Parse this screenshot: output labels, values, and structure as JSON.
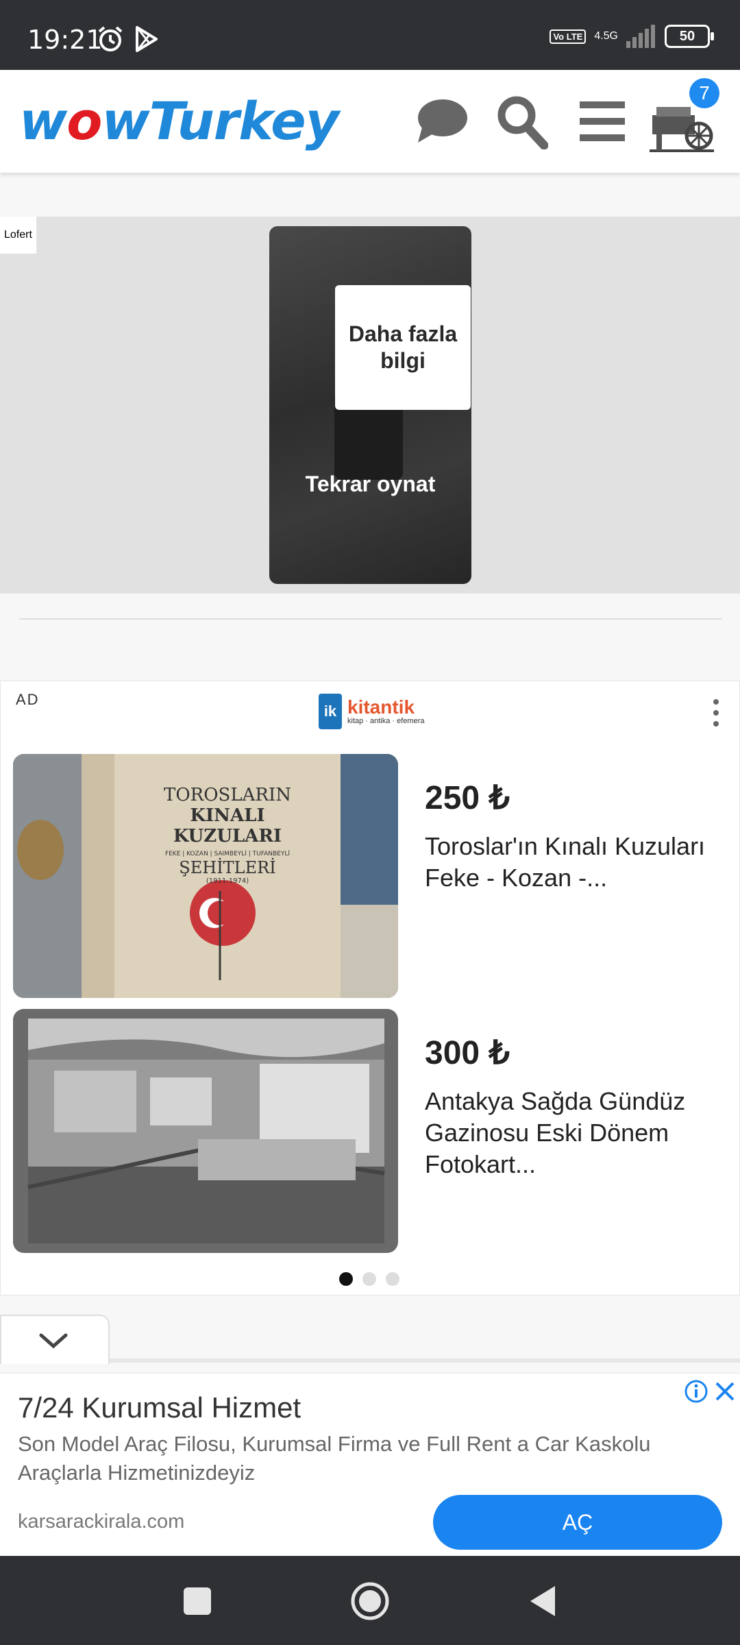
{
  "status_bar": {
    "time": "19:21",
    "volte": "Vo LTE",
    "network": "4.5G",
    "battery": "50"
  },
  "header": {
    "logo_prefix": "w",
    "logo_o": "o",
    "logo_suffix": "wTurkey",
    "cart_badge": "7"
  },
  "video_ad": {
    "label": "Lofert",
    "more_info": "Daha fazla bilgi",
    "replay": "Tekrar oynat"
  },
  "product_ad": {
    "ad_label": "AD",
    "brand": "kitantik",
    "brand_tagline": "kitap · antika · efemera",
    "products": [
      {
        "price": "250 ₺",
        "title": "Toroslar'ın Kınalı Kuzuları Feke - Kozan -...",
        "cover_title_1": "TOROSLARIN",
        "cover_title_2": "KINALI",
        "cover_title_3": "KUZULARI",
        "cover_sub": "FEKE | KOZAN | SAIMBEYLİ | TUFANBEYLİ",
        "cover_title_4": "ŞEHİTLERİ",
        "cover_years": "(1911-1974)"
      },
      {
        "price": "300 ₺",
        "title": "Antakya Sağda Gündüz Gazinosu Eski Dönem Fotokart..."
      }
    ],
    "carousel_active": 0
  },
  "banner_ad": {
    "title": "7/24 Kurumsal Hizmet",
    "description": "Son Model Araç Filosu, Kurumsal Firma ve Full Rent a Car Kaskolu Araçlarla Hizmetinizdeyiz",
    "url": "karsarackirala.com",
    "button": "AÇ"
  },
  "colors": {
    "logo_blue": "#1f88d8",
    "logo_red": "#e11b22",
    "badge_blue": "#1f8bf0",
    "cta_blue": "#1a84f0",
    "system_bar": "#2f3034"
  },
  "icons": [
    "alarm-icon",
    "play-store-icon",
    "signal-icon",
    "battery-icon",
    "chat-icon",
    "search-icon",
    "menu-icon",
    "cart-icon",
    "more-vert-icon",
    "chevron-down-icon",
    "info-icon",
    "close-icon",
    "recents-icon",
    "home-icon",
    "back-icon"
  ]
}
